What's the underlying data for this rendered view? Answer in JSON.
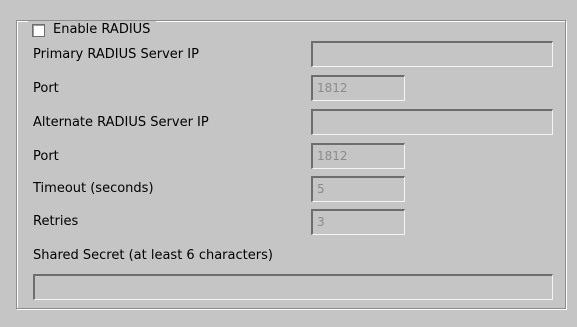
{
  "radius": {
    "enable_label": "Enable RADIUS",
    "enable_checked": false,
    "primary_label": "Primary RADIUS Server IP",
    "primary_value": "",
    "primary_port_label": "Port",
    "primary_port_value": "1812",
    "alternate_label": "Alternate RADIUS Server IP",
    "alternate_value": "",
    "alternate_port_label": "Port",
    "alternate_port_value": "1812",
    "timeout_label": "Timeout (seconds)",
    "timeout_value": "5",
    "retries_label": "Retries",
    "retries_value": "3",
    "secret_label": "Shared Secret (at least 6 characters)",
    "secret_value": ""
  }
}
